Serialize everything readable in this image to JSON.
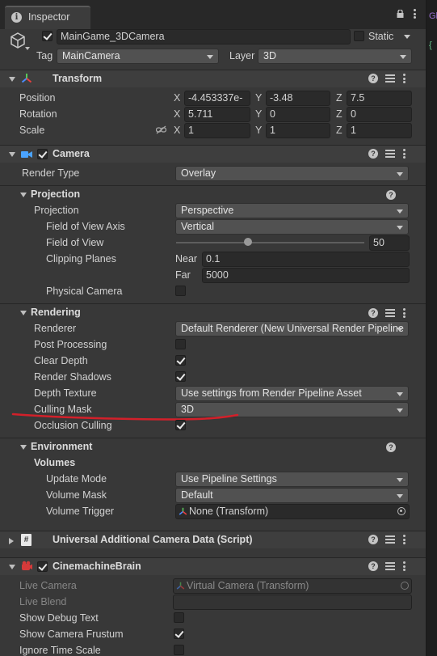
{
  "tab": {
    "title": "Inspector"
  },
  "side_fragments": {
    "top": "Gl",
    "lower": "{"
  },
  "object": {
    "name": "MainGame_3DCamera",
    "static_label": "Static",
    "tag_label": "Tag",
    "tag_value": "MainCamera",
    "layer_label": "Layer",
    "layer_value": "3D"
  },
  "transform": {
    "title": "Transform",
    "position_label": "Position",
    "rotation_label": "Rotation",
    "scale_label": "Scale",
    "x": "X",
    "y": "Y",
    "z": "Z",
    "position": {
      "x": "-4.453337e-",
      "y": "-3.48",
      "z": "7.5"
    },
    "rotation": {
      "x": "5.711",
      "y": "0",
      "z": "0"
    },
    "scale": {
      "x": "1",
      "y": "1",
      "z": "1"
    }
  },
  "camera": {
    "title": "Camera",
    "render_type_label": "Render Type",
    "render_type": "Overlay",
    "projection": {
      "title": "Projection",
      "projection_label": "Projection",
      "projection_value": "Perspective",
      "fov_axis_label": "Field of View Axis",
      "fov_axis_value": "Vertical",
      "fov_label": "Field of View",
      "fov_value": "50",
      "fov_slider_fraction": 0.38,
      "clipping_label": "Clipping Planes",
      "near_label": "Near",
      "near_value": "0.1",
      "far_label": "Far",
      "far_value": "5000",
      "physical_label": "Physical Camera",
      "physical_checked": false
    },
    "rendering": {
      "title": "Rendering",
      "renderer_label": "Renderer",
      "renderer_value": "Default Renderer (New Universal Render Pipeline",
      "post_label": "Post Processing",
      "post_checked": false,
      "clear_depth_label": "Clear Depth",
      "clear_depth_checked": true,
      "shadows_label": "Render Shadows",
      "shadows_checked": true,
      "depth_tex_label": "Depth Texture",
      "depth_tex_value": "Use settings from Render Pipeline Asset",
      "culling_label": "Culling Mask",
      "culling_value": "3D",
      "occlusion_label": "Occlusion Culling",
      "occlusion_checked": true
    },
    "environment": {
      "title": "Environment",
      "volumes_label": "Volumes",
      "update_mode_label": "Update Mode",
      "update_mode_value": "Use Pipeline Settings",
      "volume_mask_label": "Volume Mask",
      "volume_mask_value": "Default",
      "volume_trigger_label": "Volume Trigger",
      "volume_trigger_value": "None (Transform)"
    }
  },
  "additional": {
    "title": "Universal Additional Camera Data (Script)"
  },
  "brain": {
    "title": "CinemachineBrain",
    "live_camera_label": "Live Camera",
    "live_camera_value": "Virtual Camera (Transform)",
    "live_blend_label": "Live Blend",
    "debug_label": "Show Debug Text",
    "debug_checked": false,
    "frustum_label": "Show Camera Frustum",
    "frustum_checked": true,
    "ignore_time_label": "Ignore Time Scale",
    "ignore_time_checked": false
  },
  "colors": {
    "annotation": "#d2202a",
    "accent_blue": "#4aa3ff"
  }
}
